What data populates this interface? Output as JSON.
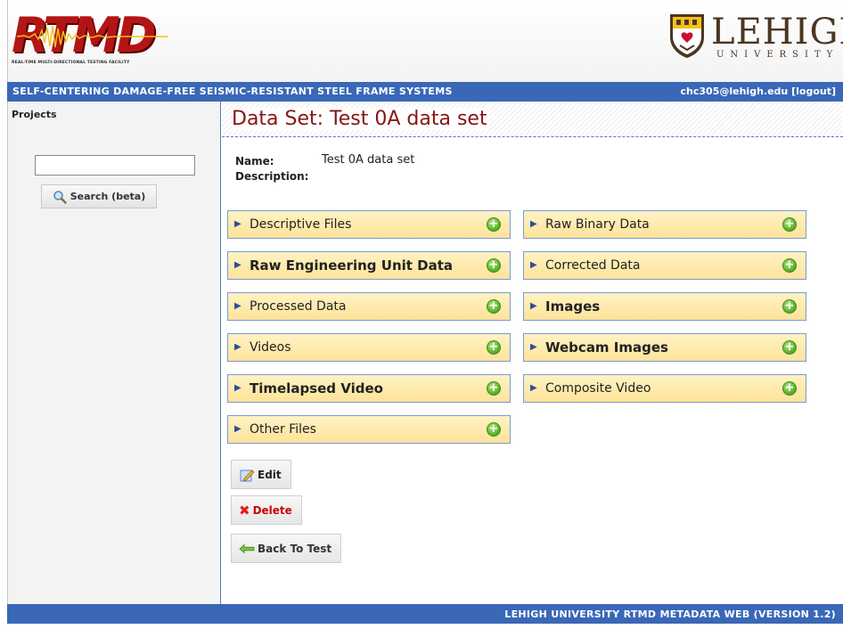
{
  "header": {
    "logo_text": "RTMD",
    "logo_tagline": "REAL-TIME MULTI-DIRECTIONAL TESTING FACILITY",
    "university_name": "LEHIGH",
    "university_sub": "UNIVERSITY"
  },
  "titlebar": {
    "project_title": "SELF-CENTERING DAMAGE-FREE SEISMIC-RESISTANT STEEL FRAME SYSTEMS",
    "user": "chc305@lehigh.edu",
    "logout": "[logout]"
  },
  "sidebar": {
    "projects_label": "Projects",
    "search": {
      "value": "",
      "placeholder": ""
    },
    "search_button": "Search (beta)"
  },
  "main": {
    "page_title": "Data Set: Test 0A data set",
    "name_label": "Name:",
    "name_value": "Test 0A data set",
    "description_label": "Description:",
    "sections": [
      {
        "label": "Descriptive Files",
        "bold": false
      },
      {
        "label": "Raw Binary Data",
        "bold": false
      },
      {
        "label": "Raw Engineering Unit Data",
        "bold": true
      },
      {
        "label": "Corrected Data",
        "bold": false
      },
      {
        "label": "Processed Data",
        "bold": false
      },
      {
        "label": "Images",
        "bold": true
      },
      {
        "label": "Videos",
        "bold": false
      },
      {
        "label": "Webcam Images",
        "bold": true
      },
      {
        "label": "Timelapsed Video",
        "bold": true
      },
      {
        "label": "Composite Video",
        "bold": false
      },
      {
        "label": "Other Files",
        "bold": false
      }
    ],
    "edit_button": "Edit",
    "delete_button": "Delete",
    "back_button": "Back To Test"
  },
  "footer": {
    "text": "LEHIGH UNIVERSITY RTMD METADATA WEB (VERSION 1.2)"
  },
  "colors": {
    "accent_blue": "#3a68b7",
    "title_red": "#8b1414",
    "section_bg": "#fde29a",
    "plus_green": "#5fb52d",
    "delete_red": "#cc0000"
  }
}
